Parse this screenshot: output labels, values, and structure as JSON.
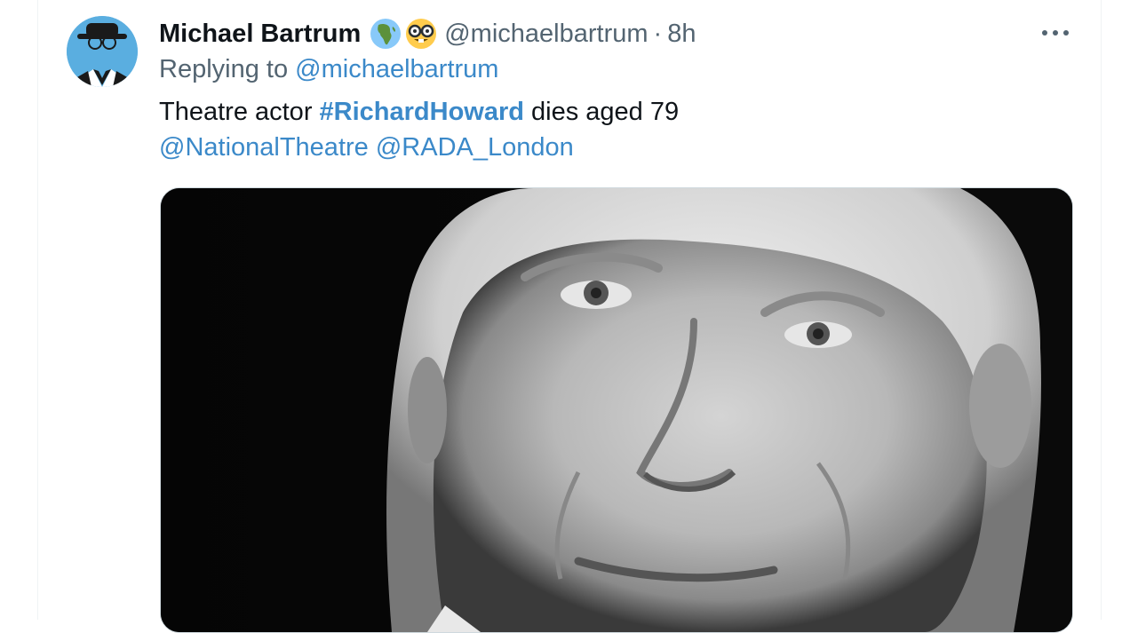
{
  "tweet": {
    "author_name": "Michael Bartrum",
    "author_emojis": [
      "globe-africa-emoji",
      "nerd-face-emoji"
    ],
    "handle": "@michaelbartrum",
    "separator": "·",
    "time": "8h",
    "replying_prefix": "Replying to",
    "replying_handle": "@michaelbartrum",
    "text_prefix": "Theatre actor ",
    "hashtag": "#RichardHoward",
    "text_suffix": " dies aged 79",
    "mention_1": "@NationalTheatre",
    "mention_2": "@RADA_London",
    "more_icon": "more-horizontal-icon",
    "media": {
      "type": "photo",
      "description_icon": "black-and-white-portrait-photo"
    }
  },
  "colors": {
    "link": "#3b89c9",
    "text": "#0f1419",
    "muted": "#536471",
    "avatar_bg": "#5aaee0"
  }
}
